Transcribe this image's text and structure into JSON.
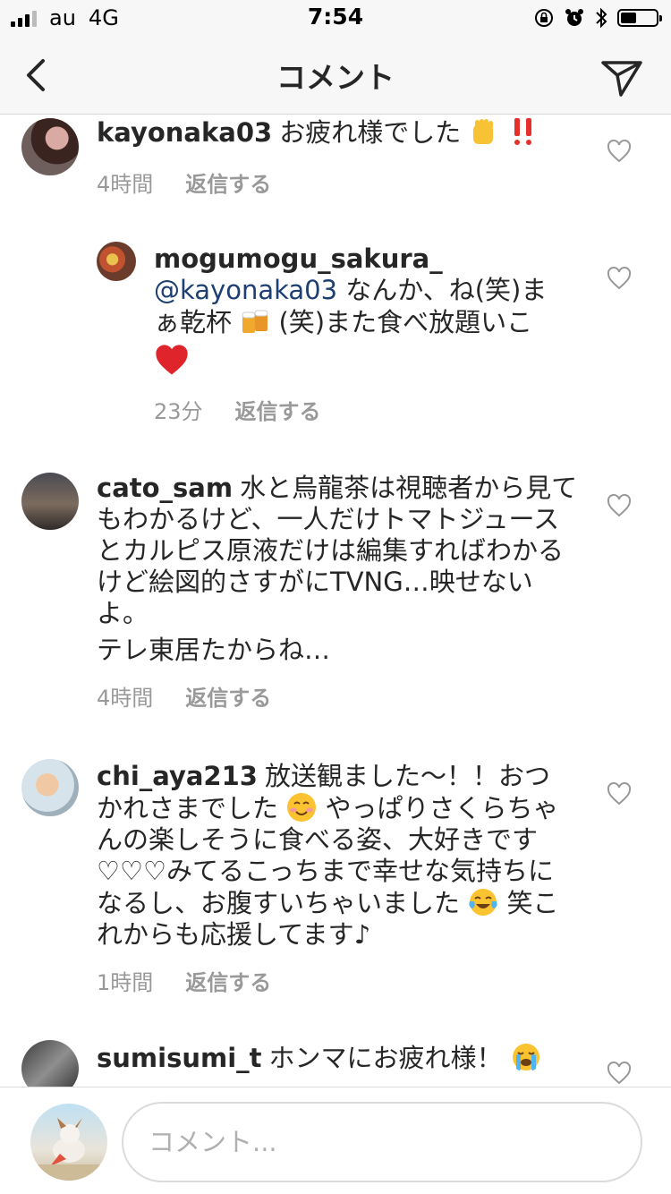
{
  "status_bar": {
    "carrier": "au",
    "network": "4G",
    "time": "7:54",
    "battery_level": 0.45,
    "icons": [
      "rotation-lock-icon",
      "alarm-icon",
      "bluetooth-icon",
      "battery-icon"
    ]
  },
  "nav": {
    "title": "コメント",
    "back_icon": "chevron-left-icon",
    "send_icon": "paper-plane-icon"
  },
  "comments": [
    {
      "username": "kayonaka03",
      "text": "お疲れ様でした",
      "emojis": [
        "raised-fist-emoji",
        "double-exclamation-emoji"
      ],
      "time": "4時間",
      "reply_label": "返信する"
    },
    {
      "username": "mogumogu_sakura_",
      "mention": "@kayonaka03",
      "text_a": " なんか、ね(笑)まぁ乾杯",
      "text_b": "(笑)また食べ放題いこ",
      "emojis": [
        "beer-mugs-emoji",
        "red-heart-emoji"
      ],
      "time": "23分",
      "reply_label": "返信する"
    },
    {
      "username": "cato_sam",
      "text": "水と烏龍茶は視聴者から見てもわかるけど、一人だけトマトジュースとカルピス原液だけは編集すればわかるけど絵図的さすがにTVNG…映せないよ。",
      "text_2": "テレ東居たからね…",
      "time": "4時間",
      "reply_label": "返信する"
    },
    {
      "username": "chi_aya213",
      "text_a": "放送観ました〜！！おつかれさまでした",
      "text_b": "やっぱりさくらちゃんの楽しそうに食べる姿、大好きです♡♡♡みてるこっちまで幸せな気持ちになるし、お腹すいちゃいました",
      "text_c": "笑これからも応援してます♪",
      "emojis": [
        "smiling-face-emoji",
        "tears-of-joy-emoji"
      ],
      "time": "1時間",
      "reply_label": "返信する"
    },
    {
      "username": "sumisumi_t",
      "text": "ホンマにお疲れ様！",
      "emojis": [
        "loudly-crying-emoji"
      ]
    }
  ],
  "input": {
    "placeholder": "コメント..."
  }
}
